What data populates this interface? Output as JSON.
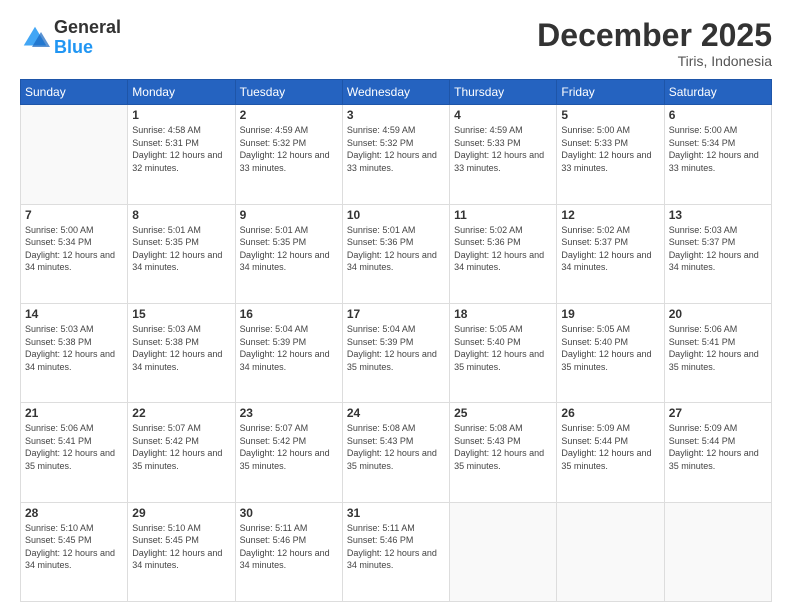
{
  "logo": {
    "general": "General",
    "blue": "Blue"
  },
  "header": {
    "title": "December 2025",
    "subtitle": "Tiris, Indonesia"
  },
  "weekdays": [
    "Sunday",
    "Monday",
    "Tuesday",
    "Wednesday",
    "Thursday",
    "Friday",
    "Saturday"
  ],
  "weeks": [
    [
      {
        "day": "",
        "info": ""
      },
      {
        "day": "1",
        "info": "Sunrise: 4:58 AM\nSunset: 5:31 PM\nDaylight: 12 hours\nand 32 minutes."
      },
      {
        "day": "2",
        "info": "Sunrise: 4:59 AM\nSunset: 5:32 PM\nDaylight: 12 hours\nand 33 minutes."
      },
      {
        "day": "3",
        "info": "Sunrise: 4:59 AM\nSunset: 5:32 PM\nDaylight: 12 hours\nand 33 minutes."
      },
      {
        "day": "4",
        "info": "Sunrise: 4:59 AM\nSunset: 5:33 PM\nDaylight: 12 hours\nand 33 minutes."
      },
      {
        "day": "5",
        "info": "Sunrise: 5:00 AM\nSunset: 5:33 PM\nDaylight: 12 hours\nand 33 minutes."
      },
      {
        "day": "6",
        "info": "Sunrise: 5:00 AM\nSunset: 5:34 PM\nDaylight: 12 hours\nand 33 minutes."
      }
    ],
    [
      {
        "day": "7",
        "info": ""
      },
      {
        "day": "8",
        "info": "Sunrise: 5:01 AM\nSunset: 5:35 PM\nDaylight: 12 hours\nand 34 minutes."
      },
      {
        "day": "9",
        "info": "Sunrise: 5:01 AM\nSunset: 5:35 PM\nDaylight: 12 hours\nand 34 minutes."
      },
      {
        "day": "10",
        "info": "Sunrise: 5:01 AM\nSunset: 5:36 PM\nDaylight: 12 hours\nand 34 minutes."
      },
      {
        "day": "11",
        "info": "Sunrise: 5:02 AM\nSunset: 5:36 PM\nDaylight: 12 hours\nand 34 minutes."
      },
      {
        "day": "12",
        "info": "Sunrise: 5:02 AM\nSunset: 5:37 PM\nDaylight: 12 hours\nand 34 minutes."
      },
      {
        "day": "13",
        "info": "Sunrise: 5:03 AM\nSunset: 5:37 PM\nDaylight: 12 hours\nand 34 minutes."
      }
    ],
    [
      {
        "day": "14",
        "info": ""
      },
      {
        "day": "15",
        "info": "Sunrise: 5:03 AM\nSunset: 5:38 PM\nDaylight: 12 hours\nand 34 minutes."
      },
      {
        "day": "16",
        "info": "Sunrise: 5:04 AM\nSunset: 5:39 PM\nDaylight: 12 hours\nand 34 minutes."
      },
      {
        "day": "17",
        "info": "Sunrise: 5:04 AM\nSunset: 5:39 PM\nDaylight: 12 hours\nand 35 minutes."
      },
      {
        "day": "18",
        "info": "Sunrise: 5:05 AM\nSunset: 5:40 PM\nDaylight: 12 hours\nand 35 minutes."
      },
      {
        "day": "19",
        "info": "Sunrise: 5:05 AM\nSunset: 5:40 PM\nDaylight: 12 hours\nand 35 minutes."
      },
      {
        "day": "20",
        "info": "Sunrise: 5:06 AM\nSunset: 5:41 PM\nDaylight: 12 hours\nand 35 minutes."
      }
    ],
    [
      {
        "day": "21",
        "info": ""
      },
      {
        "day": "22",
        "info": "Sunrise: 5:07 AM\nSunset: 5:42 PM\nDaylight: 12 hours\nand 35 minutes."
      },
      {
        "day": "23",
        "info": "Sunrise: 5:07 AM\nSunset: 5:42 PM\nDaylight: 12 hours\nand 35 minutes."
      },
      {
        "day": "24",
        "info": "Sunrise: 5:08 AM\nSunset: 5:43 PM\nDaylight: 12 hours\nand 35 minutes."
      },
      {
        "day": "25",
        "info": "Sunrise: 5:08 AM\nSunset: 5:43 PM\nDaylight: 12 hours\nand 35 minutes."
      },
      {
        "day": "26",
        "info": "Sunrise: 5:09 AM\nSunset: 5:44 PM\nDaylight: 12 hours\nand 35 minutes."
      },
      {
        "day": "27",
        "info": "Sunrise: 5:09 AM\nSunset: 5:44 PM\nDaylight: 12 hours\nand 35 minutes."
      }
    ],
    [
      {
        "day": "28",
        "info": "Sunrise: 5:10 AM\nSunset: 5:45 PM\nDaylight: 12 hours\nand 34 minutes."
      },
      {
        "day": "29",
        "info": "Sunrise: 5:10 AM\nSunset: 5:45 PM\nDaylight: 12 hours\nand 34 minutes."
      },
      {
        "day": "30",
        "info": "Sunrise: 5:11 AM\nSunset: 5:46 PM\nDaylight: 12 hours\nand 34 minutes."
      },
      {
        "day": "31",
        "info": "Sunrise: 5:11 AM\nSunset: 5:46 PM\nDaylight: 12 hours\nand 34 minutes."
      },
      {
        "day": "",
        "info": ""
      },
      {
        "day": "",
        "info": ""
      },
      {
        "day": "",
        "info": ""
      }
    ]
  ],
  "week1_sun_info": "Sunrise: 5:00 AM\nSunset: 5:34 PM\nDaylight: 12 hours\nand 33 minutes.",
  "week2_sun_info": "Sunrise: 5:00 AM\nSunset: 5:34 PM\nDaylight: 12 hours\nand 34 minutes.",
  "week3_sun_info": "Sunrise: 5:03 AM\nSunset: 5:38 PM\nDaylight: 12 hours\nand 34 minutes.",
  "week4_sun_info": "Sunrise: 5:06 AM\nSunset: 5:41 PM\nDaylight: 12 hours\nand 35 minutes."
}
